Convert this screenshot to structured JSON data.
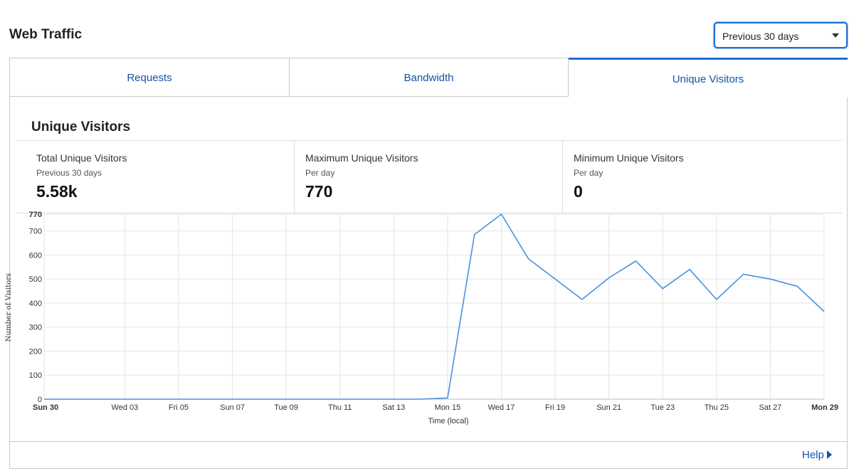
{
  "header": {
    "title": "Web Traffic"
  },
  "range_select": {
    "value": "Previous 30 days"
  },
  "tabs": [
    {
      "label": "Requests"
    },
    {
      "label": "Bandwidth"
    },
    {
      "label": "Unique Visitors",
      "active": true
    }
  ],
  "section": {
    "title": "Unique Visitors"
  },
  "stats": [
    {
      "label": "Total Unique Visitors",
      "sub": "Previous 30 days",
      "value": "5.58k"
    },
    {
      "label": "Maximum Unique Visitors",
      "sub": "Per day",
      "value": "770"
    },
    {
      "label": "Minimum Unique Visitors",
      "sub": "Per day",
      "value": "0"
    }
  ],
  "footer": {
    "help_label": "Help"
  },
  "colors": {
    "accent": "#1f6fd6",
    "link": "#1155aa",
    "line": "#4a90e2"
  },
  "chart_data": {
    "type": "line",
    "xlabel": "Time (local)",
    "ylabel": "Number of Visitors",
    "ylim": [
      0,
      770
    ],
    "y_ticks": [
      0,
      100,
      200,
      300,
      400,
      500,
      600,
      700,
      770
    ],
    "grid": true,
    "legend": "none",
    "x_tick_labels": [
      "Sun 30",
      "Wed 03",
      "Fri 05",
      "Sun 07",
      "Tue 09",
      "Thu 11",
      "Sat 13",
      "Mon 15",
      "Wed 17",
      "Fri 19",
      "Sun 21",
      "Tue 23",
      "Thu 25",
      "Sat 27",
      "Mon 29"
    ],
    "x_tick_days": [
      0,
      3,
      5,
      7,
      9,
      11,
      13,
      15,
      17,
      19,
      21,
      23,
      25,
      27,
      29
    ],
    "series": [
      {
        "x": [
          0,
          1,
          2,
          3,
          4,
          5,
          6,
          7,
          8,
          9,
          10,
          11,
          12,
          13,
          14,
          15,
          16,
          17,
          18,
          19,
          20,
          21,
          22,
          23,
          24,
          25,
          26,
          27,
          28,
          29
        ],
        "values": [
          0,
          0,
          0,
          0,
          0,
          0,
          0,
          0,
          0,
          0,
          0,
          0,
          0,
          0,
          0,
          5,
          685,
          770,
          585,
          500,
          415,
          505,
          575,
          460,
          540,
          415,
          520,
          500,
          470,
          365
        ]
      }
    ]
  }
}
